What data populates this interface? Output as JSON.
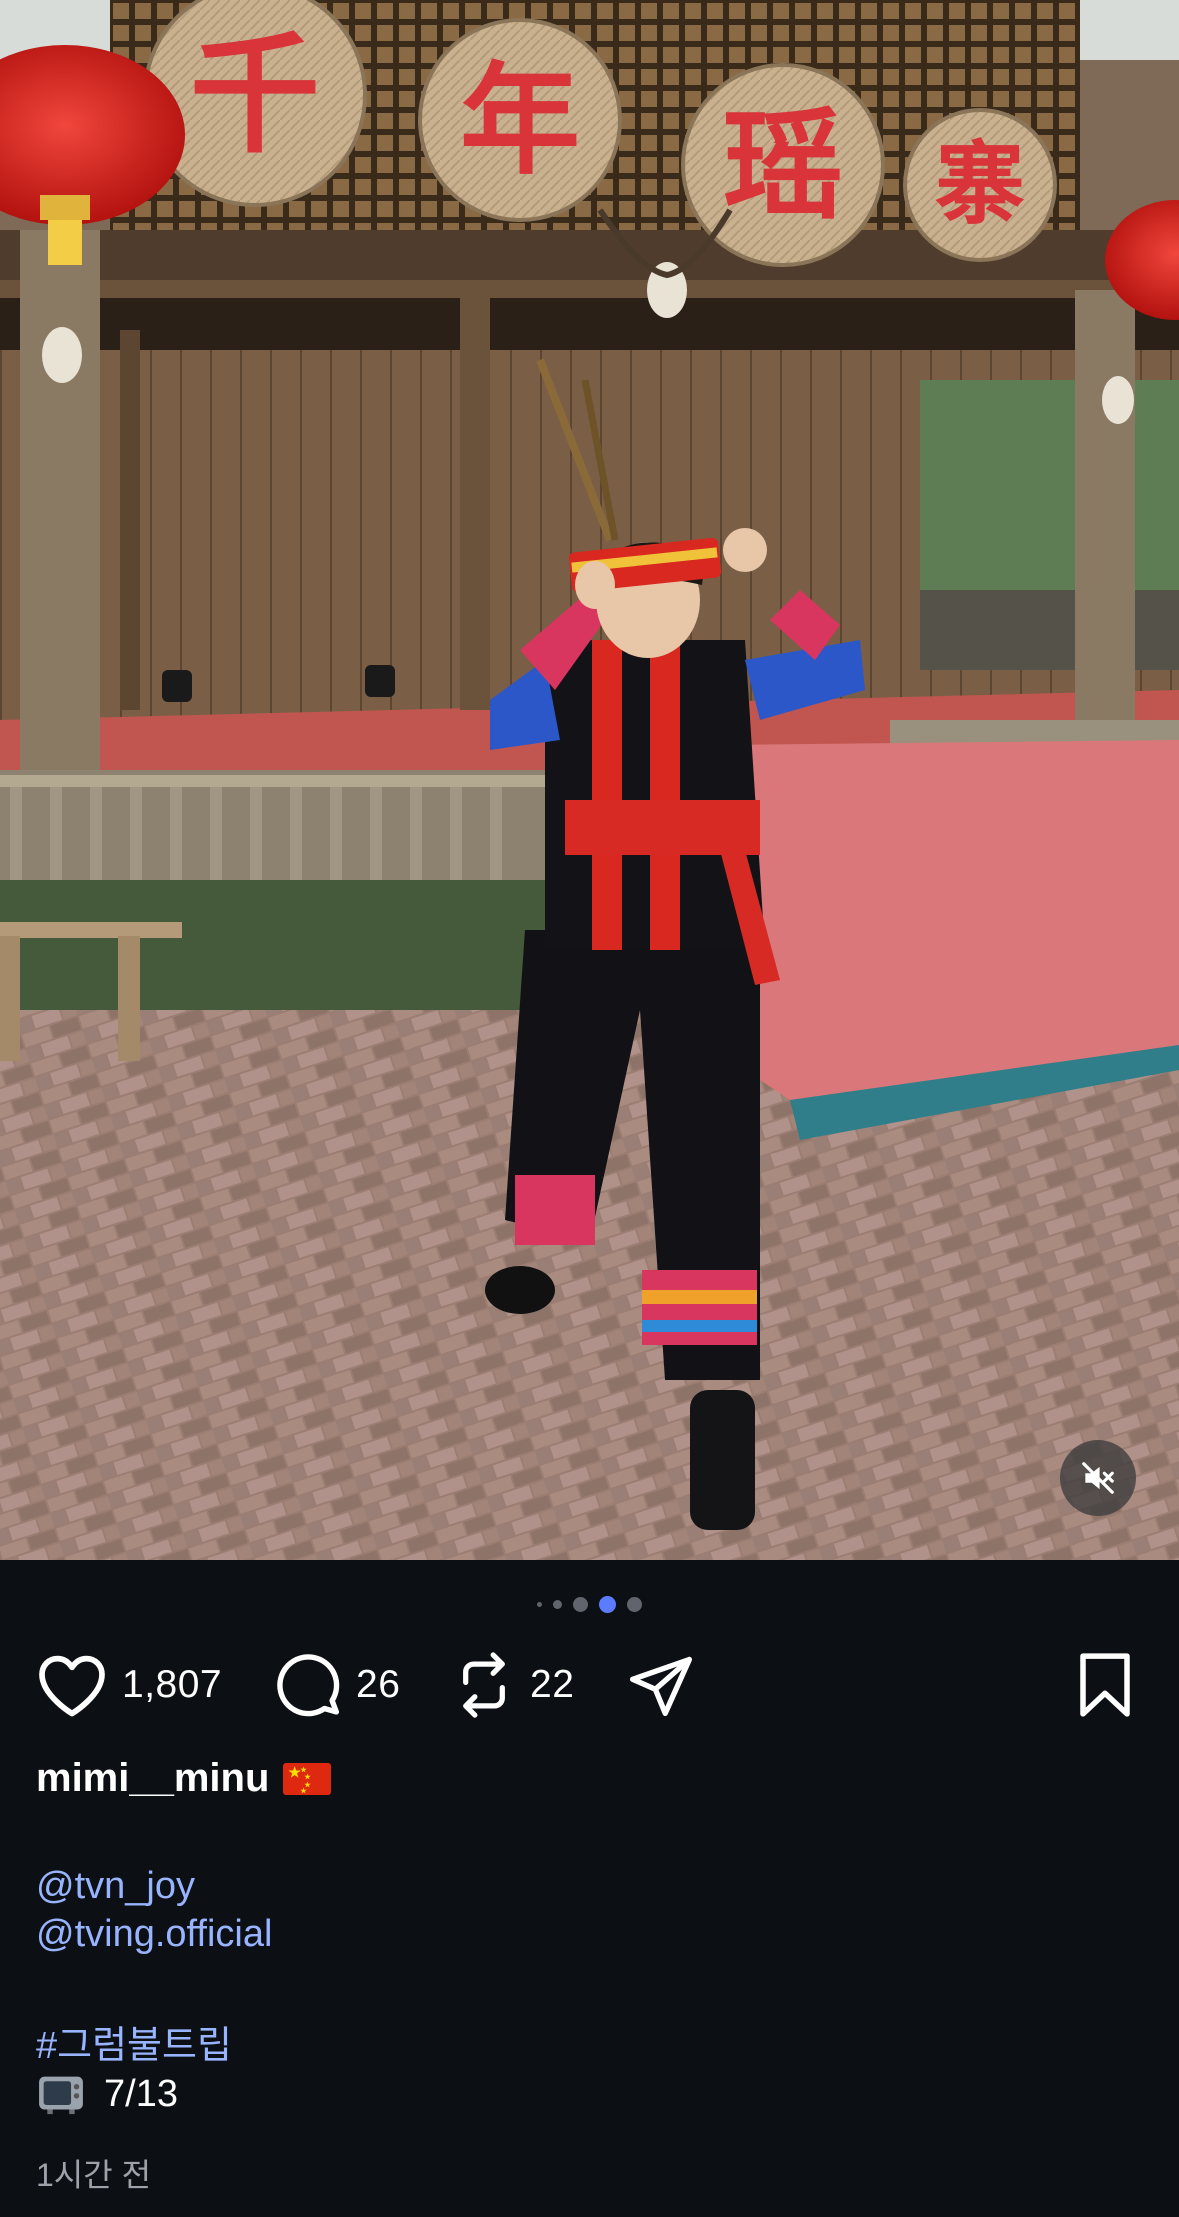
{
  "post": {
    "actions": {
      "likes": "1,807",
      "comments": "26",
      "reposts": "22"
    },
    "carousel": {
      "total": 5,
      "active_index": 3
    },
    "username": "mimi__minu",
    "caption": {
      "mention_1": "@tvn_joy",
      "mention_2": "@tving.official",
      "hashtag": "#그럼불트립",
      "date_text": "7/13"
    },
    "timestamp": "1시간 전"
  },
  "media": {
    "sign_characters": [
      "千",
      "年",
      "瑶",
      "寨"
    ]
  },
  "icons": {
    "like": "heart-icon",
    "comment": "comment-bubble-icon",
    "repost": "repost-icon",
    "share": "send-icon",
    "save": "bookmark-icon",
    "mute": "speaker-muted-icon",
    "flag": "china-flag-emoji",
    "tv": "television-emoji"
  },
  "colors": {
    "background": "#0c0f14",
    "link": "#98b4ff",
    "active_dot": "#5b7cff",
    "muted_text": "#9ea3ab"
  }
}
